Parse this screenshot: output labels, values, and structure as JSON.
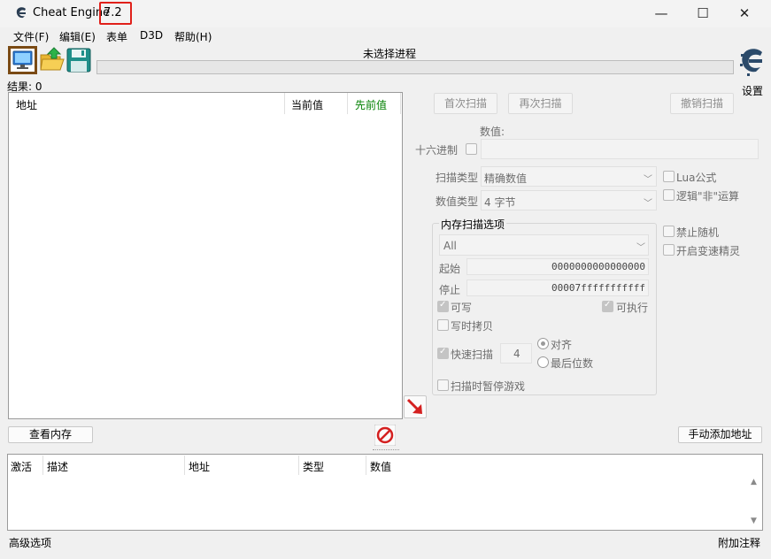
{
  "window": {
    "app_title": "Cheat Engine",
    "version": "7.2",
    "minimize_glyph": "—",
    "maximize_glyph": "☐",
    "close_glyph": "✕"
  },
  "menu": {
    "items": [
      {
        "label": "文件(F)"
      },
      {
        "label": "编辑(E)"
      },
      {
        "label": "表单"
      },
      {
        "label": "D3D"
      },
      {
        "label": "帮助(H)"
      }
    ]
  },
  "toolbar": {
    "process_title": "未选择进程",
    "settings_label": "设置",
    "icons": [
      "select-process-icon",
      "open-file-icon",
      "save-icon",
      "cheat-engine-logo"
    ]
  },
  "results": {
    "label": "结果: 0",
    "columns": [
      {
        "label": "地址"
      },
      {
        "label": "当前值"
      },
      {
        "label": "先前值"
      }
    ],
    "previous_color": "#008000"
  },
  "scan": {
    "first_scan": "首次扫描",
    "next_scan": "再次扫描",
    "undo_scan": "撤销扫描",
    "value_label": "数值:",
    "hex_label": "十六进制",
    "value_input": "",
    "scan_type_label": "扫描类型",
    "scan_type_value": "精确数值",
    "value_type_label": "数值类型",
    "value_type_value": "4 字节",
    "lua_formula": "Lua公式",
    "logical_not": "逻辑\"非\"运算",
    "memory_group": {
      "title": "内存扫描选项",
      "region": "All",
      "start_label": "起始",
      "start_value": "0000000000000000",
      "stop_label": "停止",
      "stop_value": "00007fffffffffff",
      "writable": "可写",
      "executable": "可执行",
      "copy_on_write": "写时拷贝",
      "fast_scan": "快速扫描",
      "fast_scan_value": "4",
      "align": "对齐",
      "last_digits": "最后位数",
      "pause_game": "扫描时暂停游戏"
    },
    "disable_random": "禁止随机",
    "speedhack": "开启变速精灵"
  },
  "bottom": {
    "view_memory": "查看内存",
    "add_address_manually": "手动添加地址",
    "columns": [
      {
        "label": "激活"
      },
      {
        "label": "描述"
      },
      {
        "label": "地址"
      },
      {
        "label": "类型"
      },
      {
        "label": "数值"
      }
    ]
  },
  "status": {
    "advanced_options": "高级选项",
    "table_extras": "附加注释"
  },
  "colors": {
    "version_highlight": "#e0201a",
    "process_button_border": "#7a4a14",
    "add_arrow": "#d42020",
    "stop_icon": "#d42020"
  }
}
